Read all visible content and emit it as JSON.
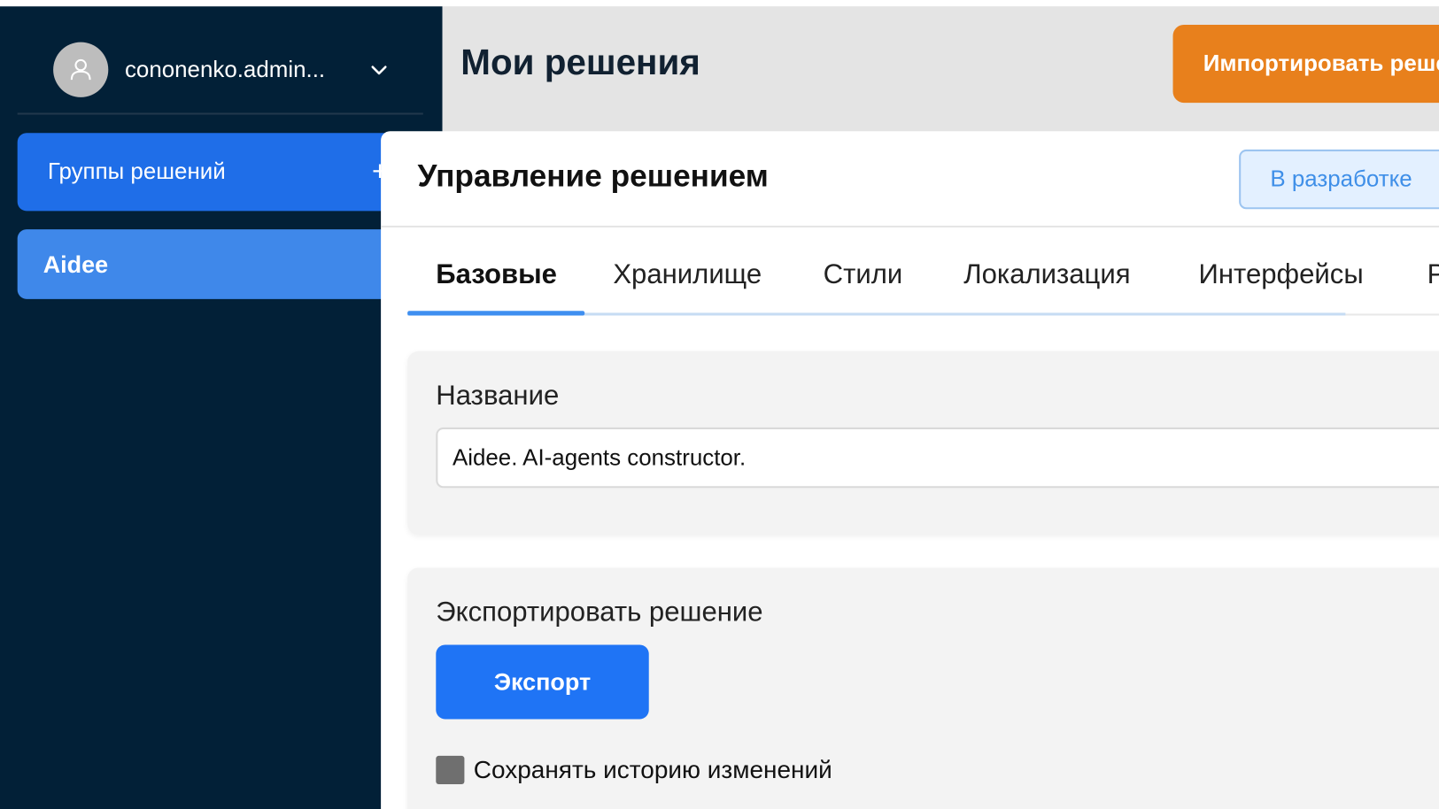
{
  "sidebar": {
    "user": {
      "name": "cononenko.admin...",
      "avatar_icon": "user-icon",
      "menu_icon": "chevron-down-icon"
    },
    "groups_button": {
      "label": "Группы решений",
      "add_icon": "plus-icon",
      "add_symbol": "+"
    },
    "items": [
      {
        "label": "Aidee",
        "active": true
      }
    ]
  },
  "header": {
    "title": "Мои решения",
    "import_button_label": "Импортировать реше"
  },
  "panel": {
    "title": "Управление решением",
    "status_label": "В разработке",
    "tabs": [
      {
        "label": "Базовые",
        "active": true
      },
      {
        "label": "Хранилище",
        "active": false
      },
      {
        "label": "Стили",
        "active": false
      },
      {
        "label": "Локализация",
        "active": false
      },
      {
        "label": "Интерфейсы",
        "active": false
      },
      {
        "label": "Р",
        "active": false
      }
    ],
    "name_section": {
      "label": "Название",
      "value": "Aidee. AI-agents constructor."
    },
    "export_section": {
      "label": "Экспортировать решение",
      "button_label": "Экспорт",
      "history_checkbox_label": "Сохранять историю изменений",
      "history_checked": false
    }
  },
  "colors": {
    "sidebar_bg": "#022037",
    "primary_blue": "#1f6ee8",
    "active_item_blue": "#3f88ea",
    "import_orange": "#e8801c",
    "status_text": "#3f8fe8",
    "export_blue": "#1f74f5"
  }
}
